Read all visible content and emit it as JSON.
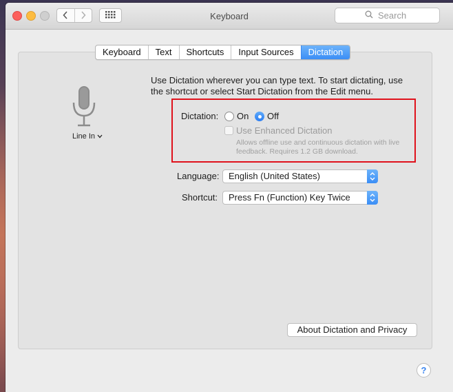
{
  "window": {
    "title": "Keyboard"
  },
  "toolbar": {
    "back_icon": "chevron-left-icon",
    "forward_icon": "chevron-right-icon",
    "grid_icon": "show-all-grid-icon",
    "search_placeholder": "Search"
  },
  "tabs": [
    {
      "label": "Keyboard",
      "active": false
    },
    {
      "label": "Text",
      "active": false
    },
    {
      "label": "Shortcuts",
      "active": false
    },
    {
      "label": "Input Sources",
      "active": false
    },
    {
      "label": "Dictation",
      "active": true
    }
  ],
  "mic": {
    "label": "Line In",
    "icon": "microphone-icon"
  },
  "intro": "Use Dictation wherever you can type text. To start dictating, use the shortcut or select Start Dictation from the Edit menu.",
  "dictation": {
    "label": "Dictation:",
    "on_label": "On",
    "off_label": "Off",
    "selected": "Off",
    "enhanced_label": "Use Enhanced Dictation",
    "enhanced_checked": false,
    "enhanced_note": "Allows offline use and continuous dictation with live feedback. Requires 1.2 GB download."
  },
  "language": {
    "label": "Language:",
    "value": "English (United States)"
  },
  "shortcut": {
    "label": "Shortcut:",
    "value": "Press Fn (Function) Key Twice"
  },
  "about_button": "About Dictation and Privacy",
  "help_label": "?",
  "colors": {
    "accent": "#3b8ef6",
    "highlight_box": "#e0111b"
  }
}
